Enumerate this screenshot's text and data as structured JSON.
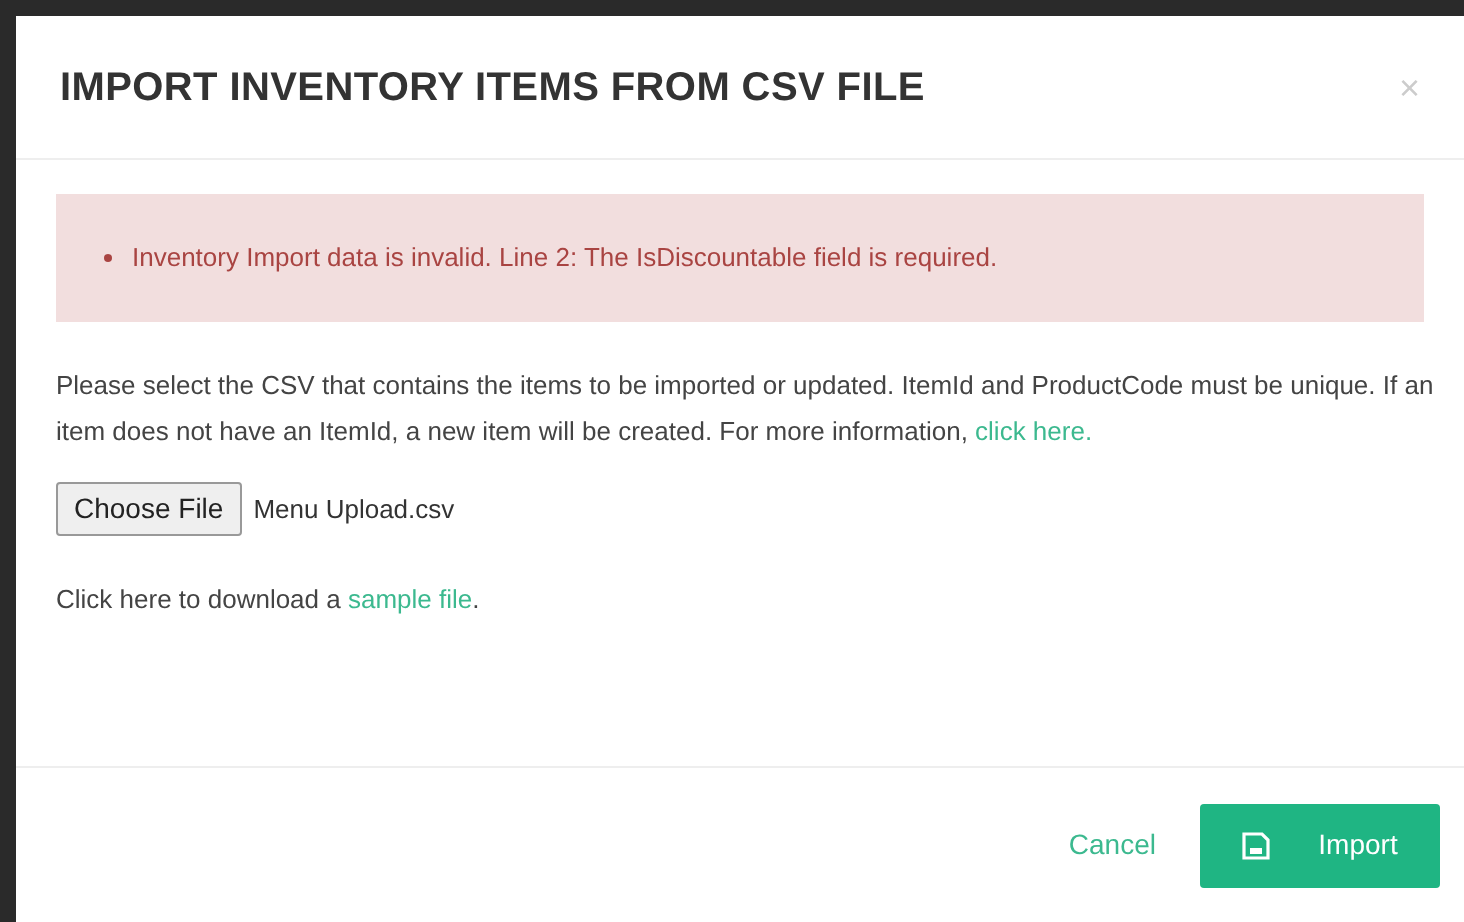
{
  "dialog": {
    "title": "IMPORT INVENTORY ITEMS FROM CSV FILE",
    "close": "×"
  },
  "errors": [
    "Inventory Import data is invalid. Line 2: The IsDiscountable field is required."
  ],
  "description": {
    "text": "Please select the CSV that contains the items to be imported or updated. ItemId and ProductCode must be unique. If an item does not have an ItemId, a new item will be created. For more information, ",
    "link": "click here."
  },
  "file_input": {
    "button": "Choose File",
    "value": "Menu Upload.csv"
  },
  "download": {
    "text": "Click here to download a ",
    "link": "sample file",
    "suffix": "."
  },
  "footer": {
    "cancel": "Cancel",
    "import": "Import"
  }
}
